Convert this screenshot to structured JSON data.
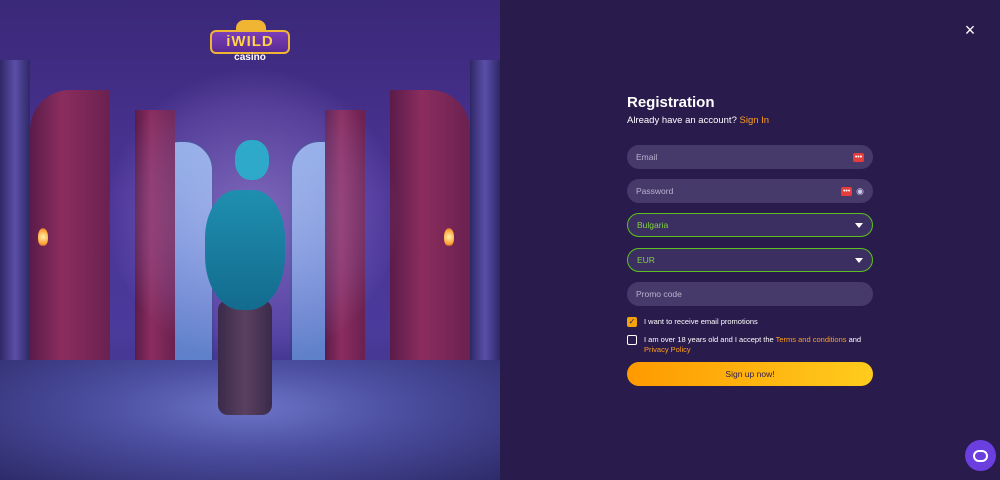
{
  "brand": {
    "logo_text": "iWILD",
    "logo_sub": "casino"
  },
  "close_icon": "×",
  "form": {
    "title": "Registration",
    "subtitle_prefix": "Already have an account?",
    "signin_link": "Sign In",
    "email_placeholder": "Email",
    "password_placeholder": "Password",
    "country_value": "Bulgaria",
    "currency_value": "EUR",
    "promo_placeholder": "Promo code",
    "badge_glyph": "•••",
    "eye_glyph": "◉",
    "checkbox_promotions": {
      "label": "I want to receive email promotions",
      "checked": true
    },
    "checkbox_terms": {
      "prefix": "I am over 18 years old and I accept the",
      "terms_link": "Terms and conditions",
      "and": "and",
      "privacy_link": "Privacy Policy",
      "checked": false
    },
    "submit_label": "Sign up now!"
  },
  "icons": {
    "close": "close-icon",
    "email_badge": "autofill-icon",
    "password_badge": "autofill-icon",
    "password_eye": "eye-icon",
    "chat": "chat-icon",
    "caret": "chevron-down-icon"
  },
  "colors": {
    "panel_bg": "#2a1b4d",
    "accent": "#ff9f1c",
    "select_border": "#5ec01e",
    "button_gradient_start": "#ff9a00",
    "button_gradient_end": "#ffcc1d"
  }
}
